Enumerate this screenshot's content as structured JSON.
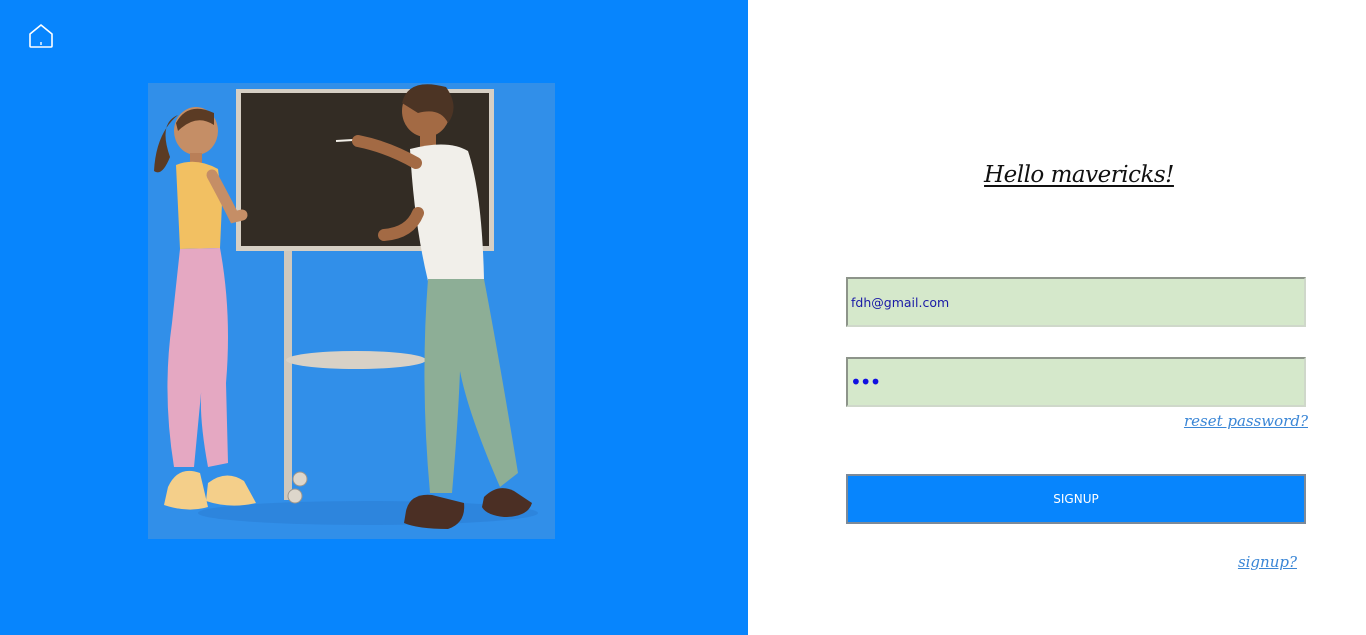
{
  "colors": {
    "panel_blue": "#0785fd",
    "illustration_bg": "#318fe9",
    "input_bg": "#d5e8cb",
    "link": "#3a86d6"
  },
  "nav": {
    "home_icon": "home-icon"
  },
  "form": {
    "title": "Hello mavericks!",
    "email_value": "fdh@gmail.com",
    "password_mask": "•••",
    "reset_link": "reset password?",
    "signup_button": "SIGNUP",
    "signup_link": "signup?"
  }
}
